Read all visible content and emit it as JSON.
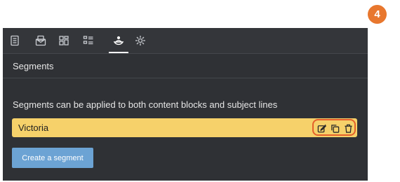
{
  "step_badge": "4",
  "toolbar": {
    "tabs": [
      {
        "icon": "document-icon",
        "active": false
      },
      {
        "icon": "envelope-icon",
        "active": false
      },
      {
        "icon": "blocks-grid-icon",
        "active": false
      },
      {
        "icon": "list-layout-icon",
        "active": false
      },
      {
        "icon": "segments-icon",
        "active": true
      },
      {
        "icon": "settings-icon",
        "active": false
      }
    ]
  },
  "section": {
    "title": "Segments",
    "description": "Segments can be applied to both content blocks and subject lines"
  },
  "segments": [
    {
      "name": "Victoria",
      "actions": [
        "edit-icon",
        "copy-icon",
        "delete-icon"
      ]
    }
  ],
  "buttons": {
    "create_segment": "Create a segment"
  },
  "colors": {
    "panel": "#2f3135",
    "segment_highlight": "#f6d16a",
    "badge": "#e8772e",
    "action_outline": "#e4602a",
    "primary_button": "#6ca3d4"
  }
}
